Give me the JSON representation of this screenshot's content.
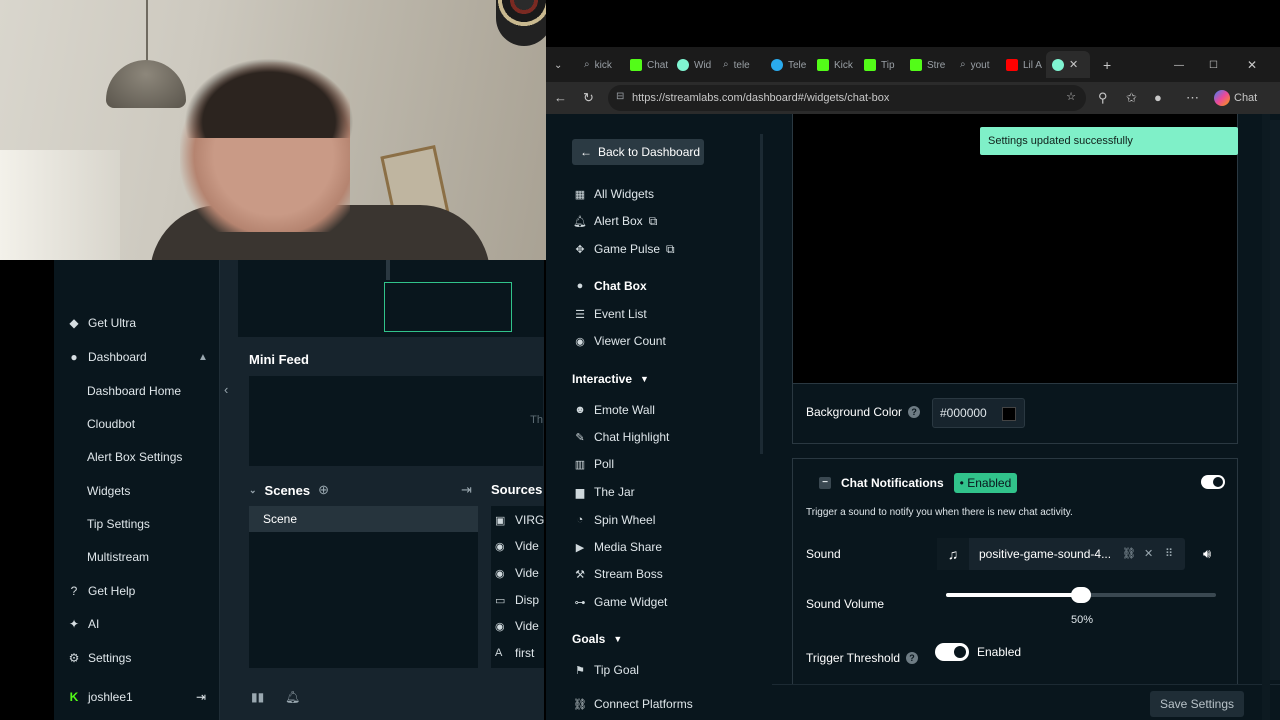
{
  "obs": {
    "sidebar": [
      {
        "label": "Get Ultra",
        "icon": "ultra-icon"
      },
      {
        "label": "Dashboard",
        "icon": "dashboard-icon"
      },
      {
        "label": "Dashboard Home"
      },
      {
        "label": "Cloudbot"
      },
      {
        "label": "Alert Box Settings"
      },
      {
        "label": "Widgets"
      },
      {
        "label": "Tip Settings"
      },
      {
        "label": "Multistream"
      },
      {
        "label": "Get Help",
        "icon": "help-icon"
      },
      {
        "label": "AI",
        "icon": "ai-icon"
      },
      {
        "label": "Settings",
        "icon": "gear-icon"
      },
      {
        "label": "joshlee1",
        "icon": "kick-logo-icon"
      }
    ],
    "mini_feed_title": "Mini Feed",
    "mini_feed_text": "Th",
    "scenes_title": "Scenes",
    "scene_name": "Scene",
    "sources_title": "Sources",
    "sources": [
      "VIRG",
      "Vide",
      "Vide",
      "Disp",
      "Vide",
      "first"
    ]
  },
  "browser": {
    "tabs": [
      "kick",
      "Chat",
      "Wid",
      "tele",
      "Tele",
      "Kick",
      "Tip",
      "Stre",
      "yout",
      "Lil A"
    ],
    "url": "https://streamlabs.com/dashboard#/widgets/chat-box",
    "chat_label": "Chat"
  },
  "nav": {
    "back": "Back to Dashboard",
    "items": [
      {
        "label": "All Widgets"
      },
      {
        "label": "Alert Box"
      },
      {
        "label": "Game Pulse"
      },
      {
        "label": "Chat Box"
      },
      {
        "label": "Event List"
      },
      {
        "label": "Viewer Count"
      }
    ],
    "interactive_title": "Interactive",
    "interactive": [
      "Emote Wall",
      "Chat Highlight",
      "Poll",
      "The Jar",
      "Spin Wheel",
      "Media Share",
      "Stream Boss",
      "Game Widget"
    ],
    "goals_title": "Goals",
    "goals": [
      "Tip Goal"
    ],
    "connect": "Connect Platforms"
  },
  "content": {
    "toast": "Settings updated successfully",
    "bg_label": "Background Color",
    "bg_value": "#000000",
    "notif_title": "Chat Notifications",
    "notif_badge": "Enabled",
    "notif_desc": "Trigger a sound to notify you when there is new chat activity.",
    "sound_label": "Sound",
    "sound_file": "positive-game-sound-4...",
    "volume_label": "Sound Volume",
    "volume_value": 0.5,
    "volume_text": "50%",
    "threshold_label": "Trigger Threshold",
    "threshold_state": "Enabled",
    "save": "Save Settings"
  }
}
